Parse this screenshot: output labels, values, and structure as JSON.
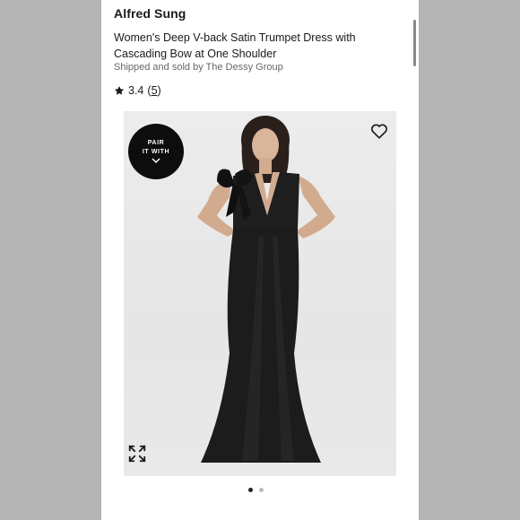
{
  "product": {
    "brand": "Alfred Sung",
    "title": "Women's Deep V-back Satin Trumpet Dress with Cascading Bow at One Shoulder",
    "seller": "Shipped and sold by The Dessy Group",
    "rating": "3.4",
    "review_count": "5"
  },
  "gallery": {
    "pair_line1": "PAIR",
    "pair_line2": "IT WITH",
    "active_index": 0,
    "total_images": 2
  },
  "icons": {
    "rating": "star-icon",
    "wishlist": "heart-icon",
    "fullscreen": "expand-icon",
    "pair": "chevron-down-icon"
  },
  "colors": {
    "dress": "#1c1c1c",
    "background": "#ffffff",
    "badge": "#0d0d0d"
  }
}
